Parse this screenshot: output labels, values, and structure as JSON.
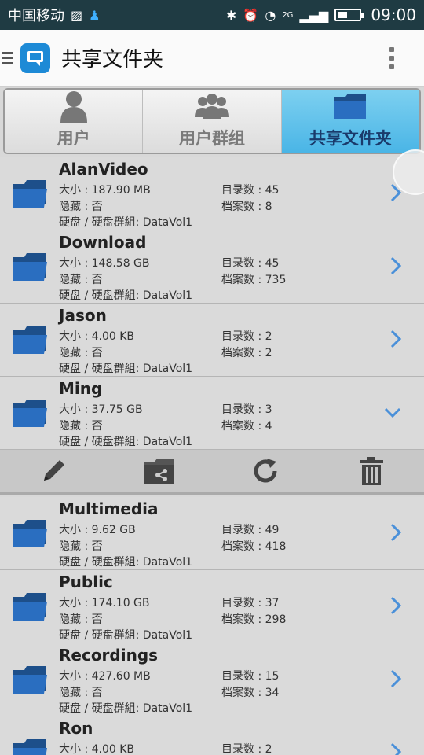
{
  "status_bar": {
    "carrier": "中国移动",
    "network": "2G",
    "time": "09:00"
  },
  "app_bar": {
    "title": "共享文件夹"
  },
  "tabs": [
    {
      "label": "用户",
      "icon": "user-icon",
      "active": false
    },
    {
      "label": "用户群组",
      "icon": "user-group-icon",
      "active": false
    },
    {
      "label": "共享文件夹",
      "icon": "folder-icon",
      "active": true
    }
  ],
  "labels": {
    "size": "大小 : ",
    "hidden": "隐藏 : ",
    "volume": "硬盘 / 硬盘群組:  ",
    "dirs": "目录数 : ",
    "files": "档案数 : "
  },
  "folders": [
    {
      "name": "AlanVideo",
      "size": "187.90 MB",
      "hidden": "否",
      "volume": "DataVol1",
      "dirs": "45",
      "files": "8"
    },
    {
      "name": "Download",
      "size": "148.58 GB",
      "hidden": "否",
      "volume": "DataVol1",
      "dirs": "45",
      "files": "735"
    },
    {
      "name": "Jason",
      "size": "4.00 KB",
      "hidden": "否",
      "volume": "DataVol1",
      "dirs": "2",
      "files": "2"
    },
    {
      "name": "Ming",
      "size": "37.75 GB",
      "hidden": "否",
      "volume": "DataVol1",
      "dirs": "3",
      "files": "4",
      "expanded": true
    },
    {
      "name": "Multimedia",
      "size": "9.62 GB",
      "hidden": "否",
      "volume": "DataVol1",
      "dirs": "49",
      "files": "418"
    },
    {
      "name": "Public",
      "size": "174.10 GB",
      "hidden": "否",
      "volume": "DataVol1",
      "dirs": "37",
      "files": "298"
    },
    {
      "name": "Recordings",
      "size": "427.60 MB",
      "hidden": "否",
      "volume": "DataVol1",
      "dirs": "15",
      "files": "34"
    },
    {
      "name": "Ron",
      "size": "4.00 KB",
      "hidden": "",
      "volume": "",
      "dirs": "2",
      "files": ""
    }
  ],
  "actions": [
    "edit-icon",
    "folder-share-icon",
    "refresh-icon",
    "trash-icon"
  ],
  "colors": {
    "accent": "#4ab5e6",
    "folder": "#2a6ec0",
    "chevron": "#4a90d9"
  }
}
